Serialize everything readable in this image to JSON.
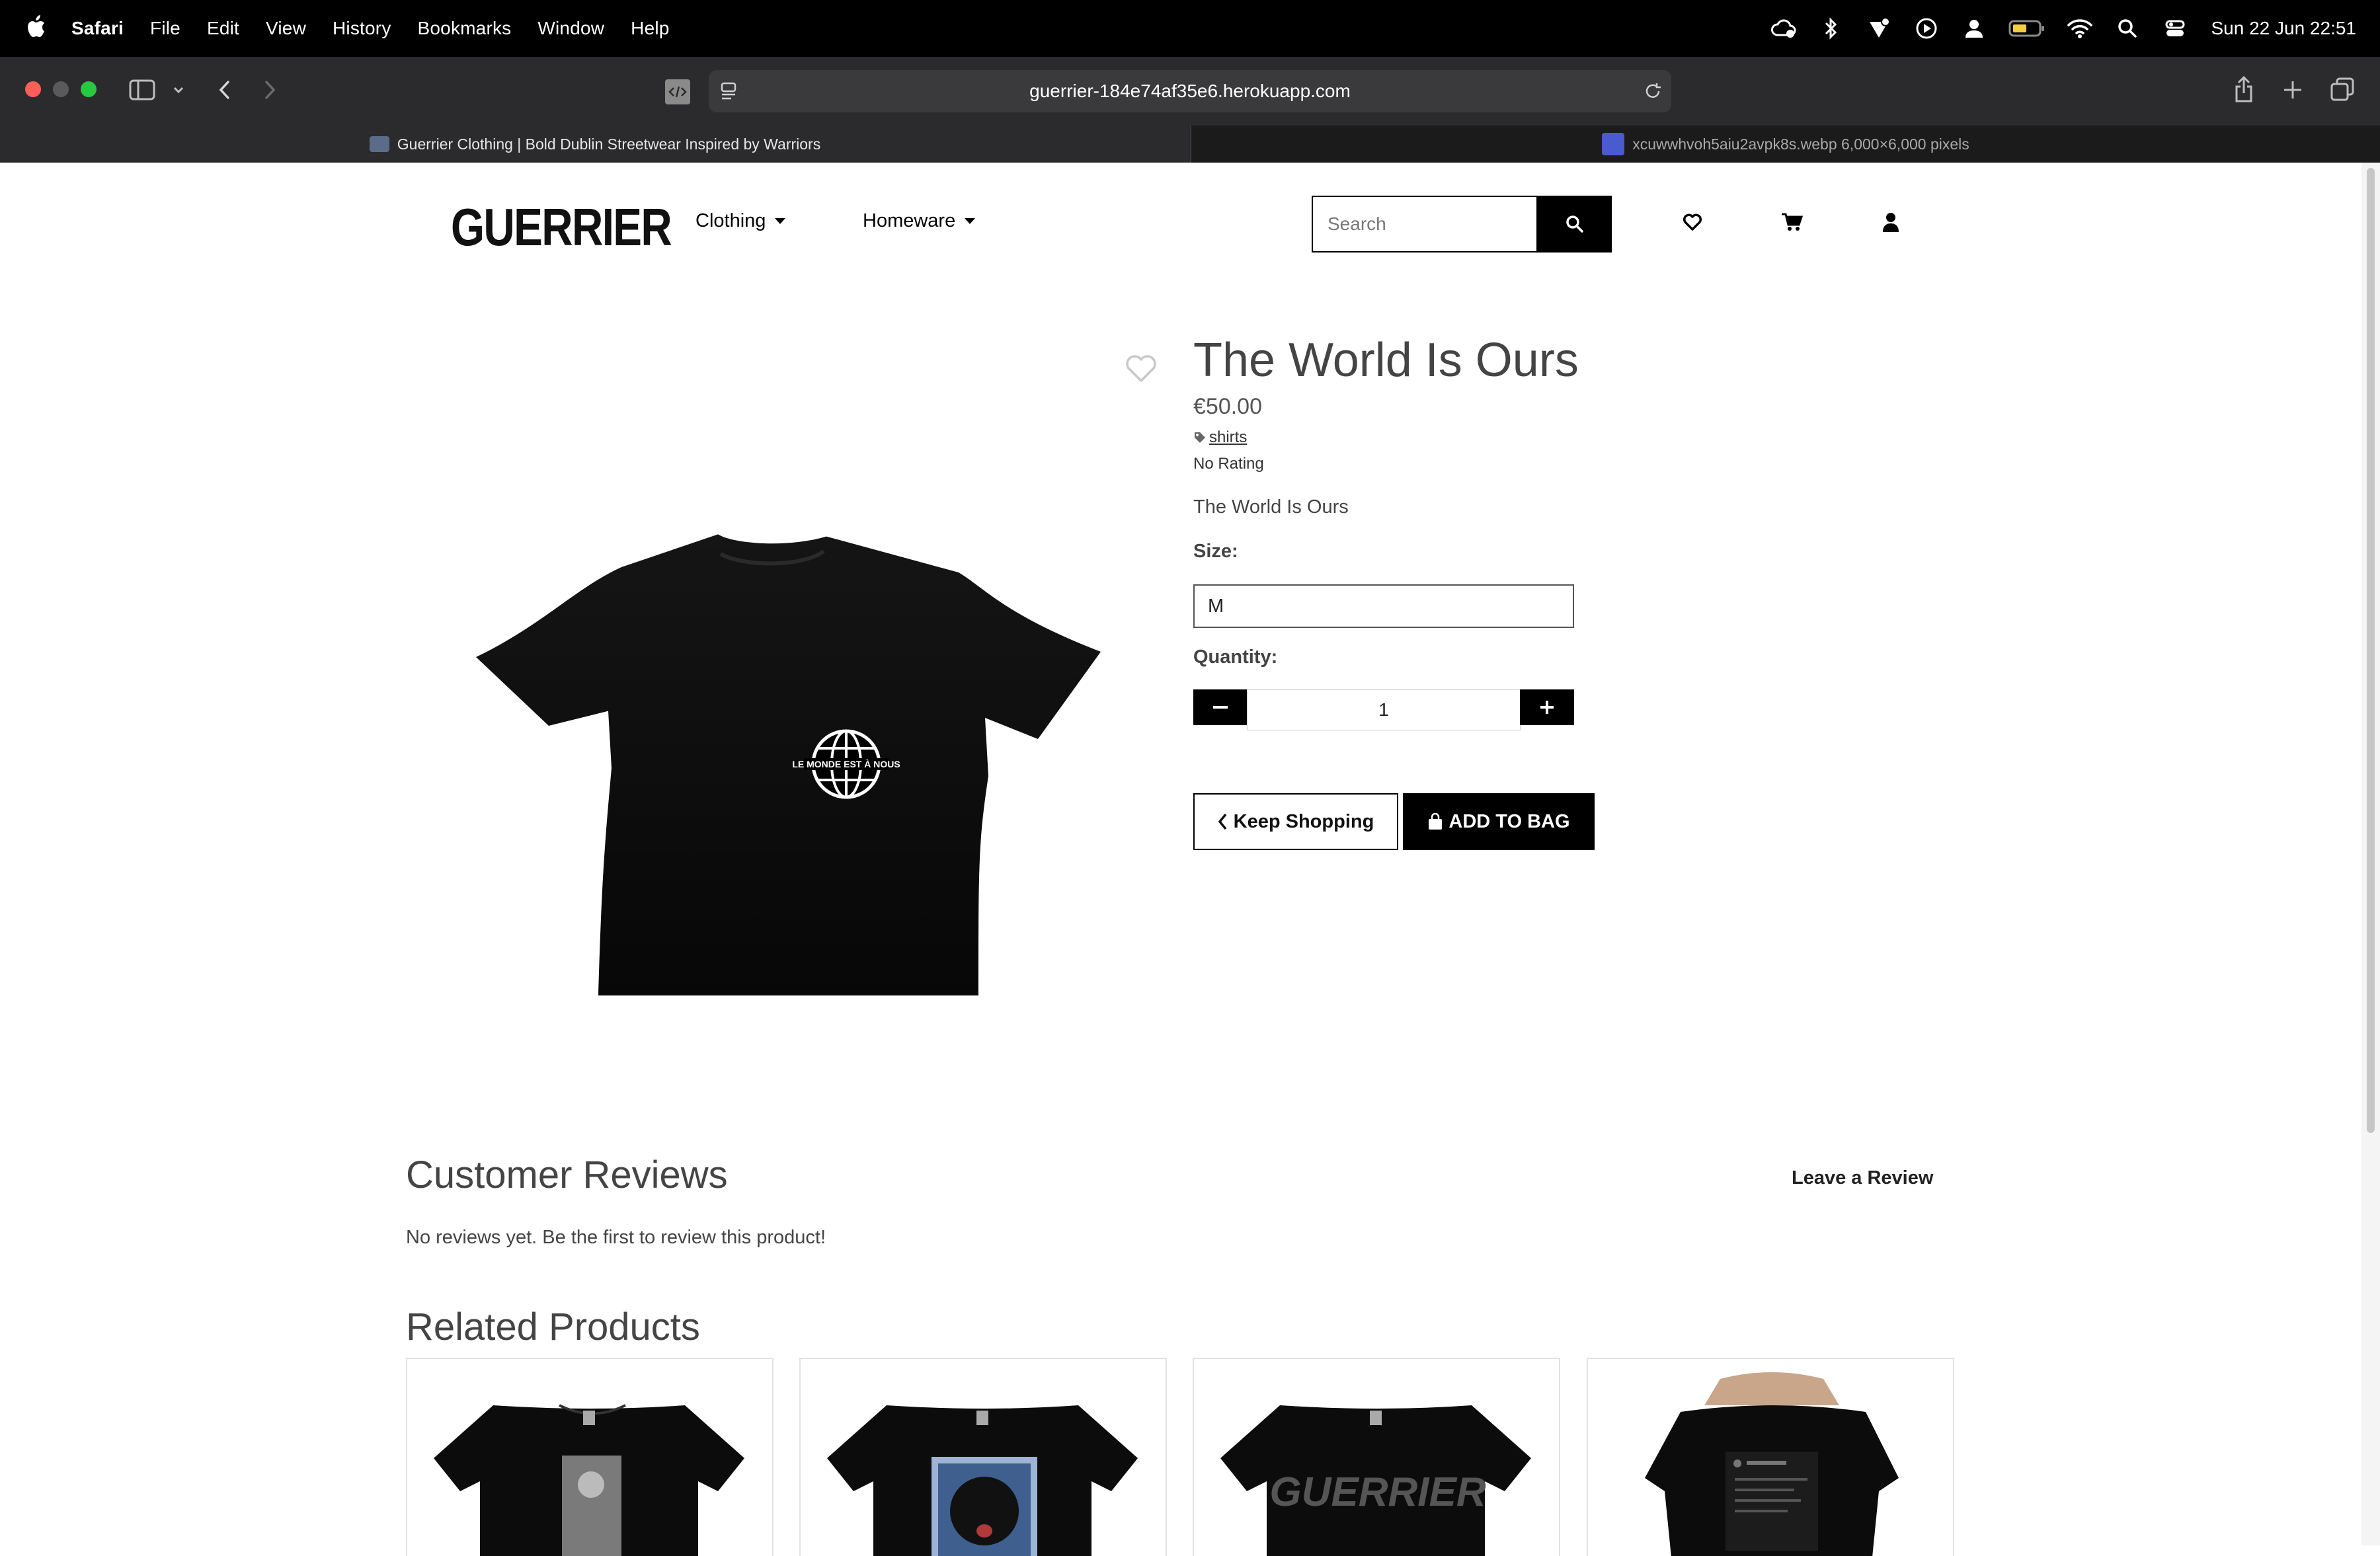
{
  "menubar": {
    "app_name": "Safari",
    "menus": [
      "File",
      "Edit",
      "View",
      "History",
      "Bookmarks",
      "Window",
      "Help"
    ],
    "clock": "Sun 22 Jun  22:51"
  },
  "browser": {
    "url": "guerrier-184e74af35e6.herokuapp.com",
    "tabs": [
      {
        "title": "Guerrier Clothing | Bold Dublin Streetwear Inspired by Warriors",
        "active": true
      },
      {
        "title": "xcuwwhvoh5aiu2avpk8s.webp 6,000×6,000 pixels",
        "active": false
      }
    ]
  },
  "site": {
    "logo": "GUERRIER",
    "nav": {
      "clothing": "Clothing",
      "homeware": "Homeware"
    },
    "search": {
      "placeholder": "Search"
    }
  },
  "product": {
    "title": "The World Is Ours",
    "price": "€50.00",
    "category": "shirts",
    "rating": "No Rating",
    "description": "The World Is Ours",
    "size_label": "Size:",
    "size_value": "M",
    "quantity_label": "Quantity:",
    "quantity_value": "1",
    "keep_shopping": "Keep Shopping",
    "add_to_bag": "ADD TO BAG",
    "print_text": "LE MONDE EST À NOUS"
  },
  "reviews": {
    "title": "Customer Reviews",
    "leave_review": "Leave a Review",
    "empty_text": "No reviews yet. Be the first to review this product!"
  },
  "related": {
    "title": "Related Products",
    "cards": [
      {
        "print": "boxer-photo"
      },
      {
        "print": "portrait-blue"
      },
      {
        "print_text": "GUERRIER"
      },
      {
        "print": "back-print"
      }
    ]
  },
  "colors": {
    "accent": "#000000",
    "menubar": "#000000",
    "toolbar": "#2b2b2d",
    "text": "#444444"
  }
}
